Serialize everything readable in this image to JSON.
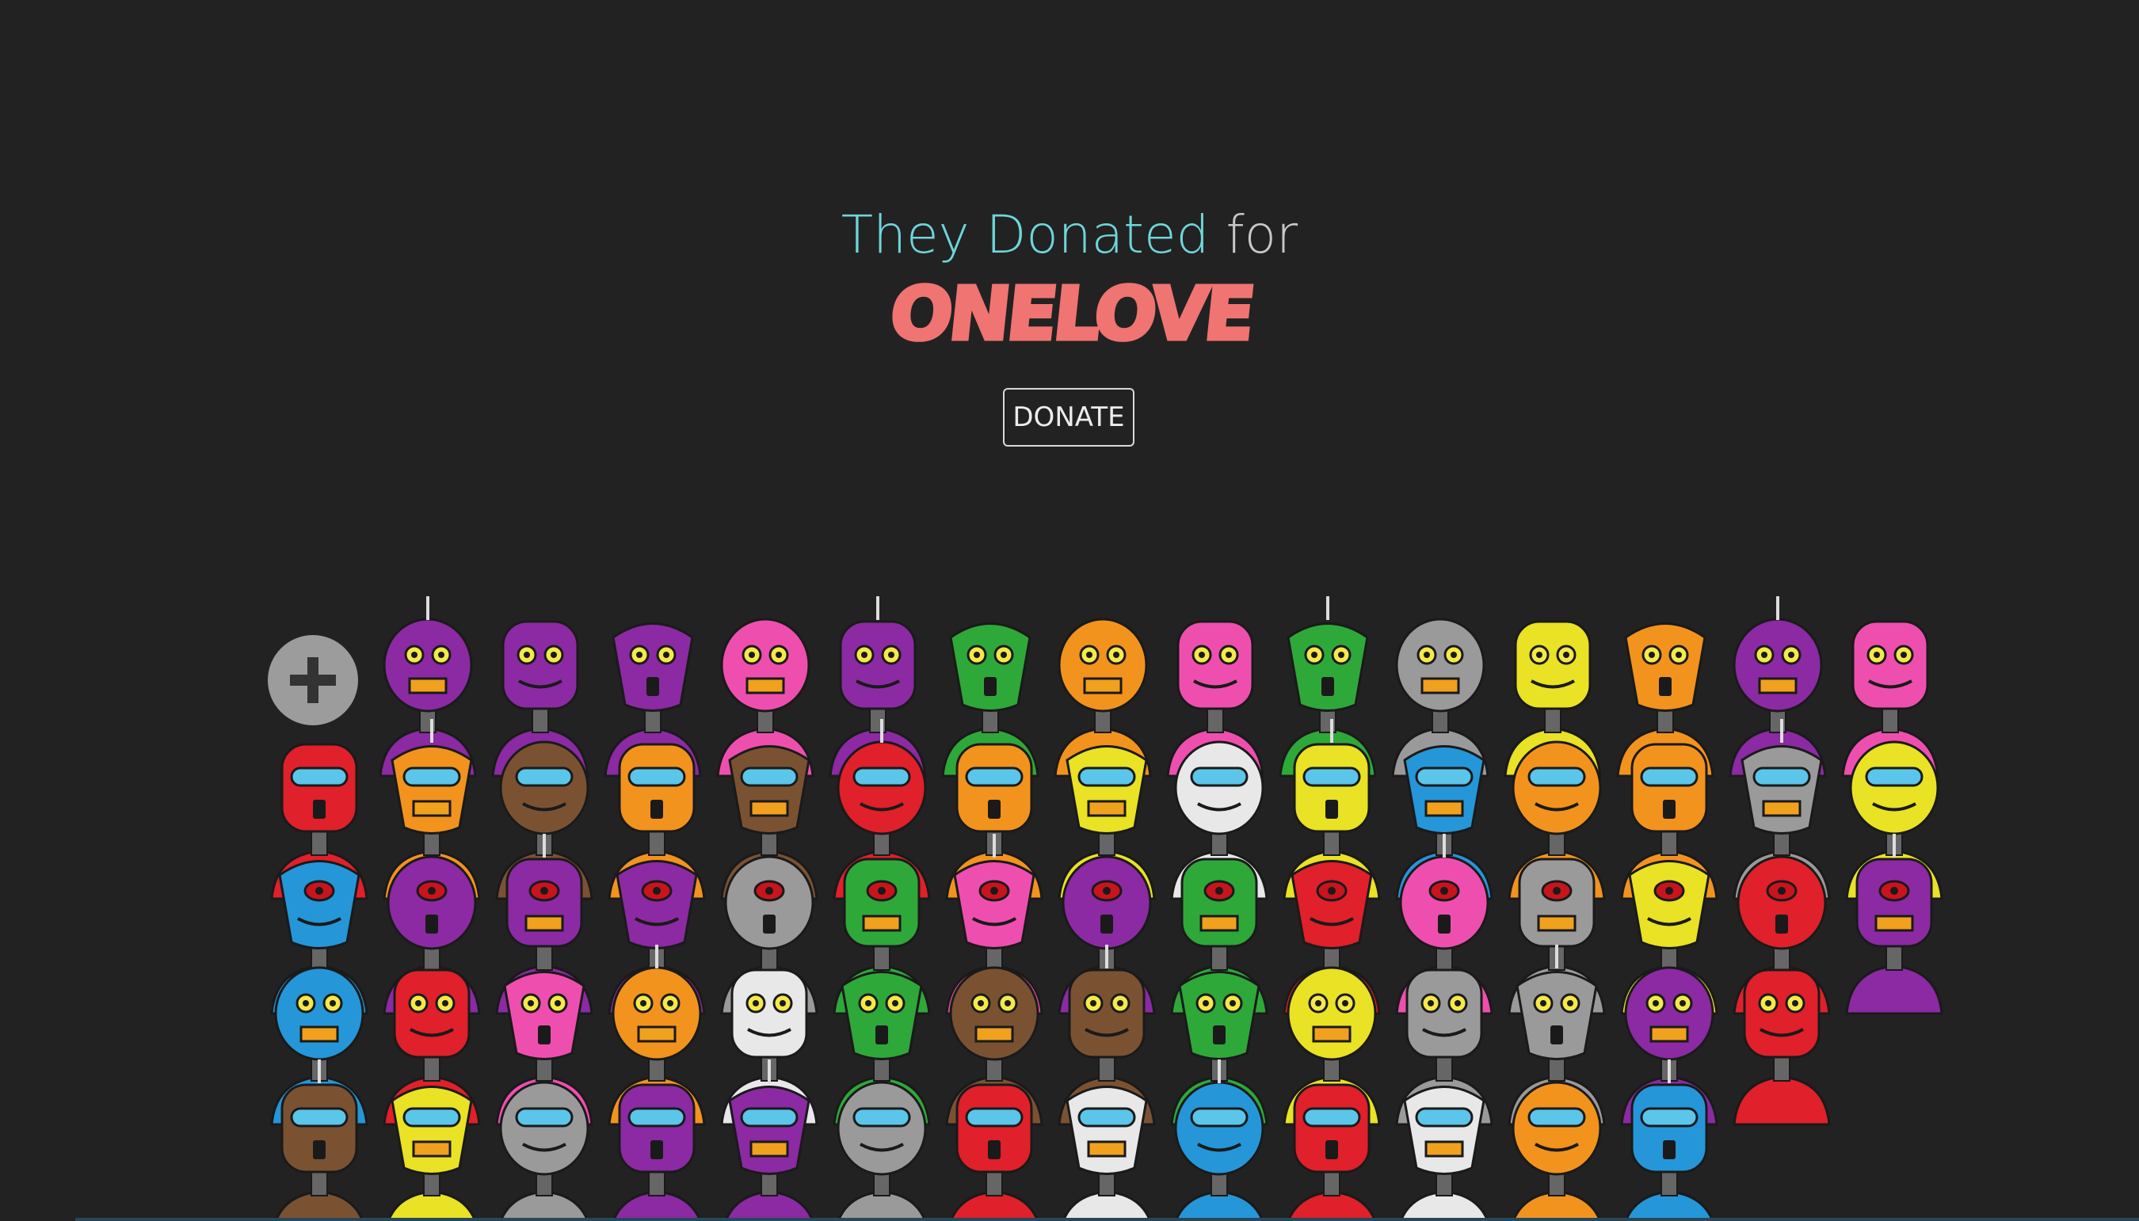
{
  "header": {
    "title_accent": "They Donated",
    "title_plain": "for",
    "brand": "ONELOVE",
    "donate_label": "DONATE"
  },
  "colors": {
    "background": "#222222",
    "accent": "#6fd6da",
    "brand": "#f07472"
  },
  "grid": {
    "add_icon": "plus-icon",
    "rows": [
      [
        "purple",
        "purple",
        "purple",
        "pink",
        "purple",
        "green",
        "orange",
        "pink",
        "green",
        "gray",
        "yellow",
        "orange",
        "purple",
        "pink"
      ],
      [
        "red",
        "orange",
        "brown",
        "orange",
        "brown",
        "red",
        "orange",
        "yellow",
        "white",
        "yellow",
        "blue",
        "orange",
        "orange",
        "gray",
        "yellow"
      ],
      [
        "blue",
        "purple",
        "purple",
        "purple",
        "gray",
        "green",
        "pink",
        "purple",
        "green",
        "red",
        "pink",
        "gray",
        "yellow",
        "red",
        "purple"
      ],
      [
        "blue",
        "red",
        "pink",
        "orange",
        "white",
        "green",
        "brown",
        "brown",
        "green",
        "yellow",
        "gray",
        "gray",
        "purple",
        "red"
      ],
      [
        "brown",
        "yellow",
        "gray",
        "purple",
        "purple",
        "gray",
        "red",
        "white",
        "blue",
        "red",
        "white",
        "orange",
        "blue"
      ]
    ]
  }
}
